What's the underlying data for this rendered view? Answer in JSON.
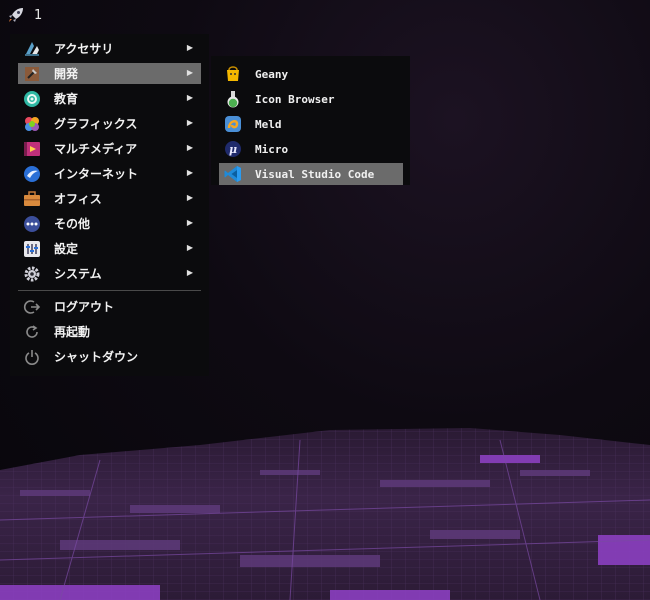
{
  "topbar": {
    "workspace": "1"
  },
  "main_menu": {
    "items": [
      {
        "label": "アクセサリ",
        "icon": "accessories-icon"
      },
      {
        "label": "開発",
        "icon": "development-icon"
      },
      {
        "label": "教育",
        "icon": "education-icon"
      },
      {
        "label": "グラフィックス",
        "icon": "graphics-icon"
      },
      {
        "label": "マルチメディア",
        "icon": "multimedia-icon"
      },
      {
        "label": "インターネット",
        "icon": "internet-icon"
      },
      {
        "label": "オフィス",
        "icon": "office-icon"
      },
      {
        "label": "その他",
        "icon": "other-icon"
      },
      {
        "label": "設定",
        "icon": "settings-icon"
      },
      {
        "label": "システム",
        "icon": "system-icon"
      }
    ],
    "session": [
      {
        "label": "ログアウト",
        "icon": "logout-icon"
      },
      {
        "label": "再起動",
        "icon": "reboot-icon"
      },
      {
        "label": "シャットダウン",
        "icon": "shutdown-icon"
      }
    ],
    "selected": "開発",
    "arrow": "▶"
  },
  "sub_menu": {
    "items": [
      {
        "label": "Geany",
        "icon": "geany-icon"
      },
      {
        "label": "Icon Browser",
        "icon": "icon-browser-icon"
      },
      {
        "label": "Meld",
        "icon": "meld-icon"
      },
      {
        "label": "Micro",
        "icon": "micro-icon"
      },
      {
        "label": "Visual Studio Code",
        "icon": "vscode-icon"
      }
    ],
    "selected": "Visual Studio Code"
  },
  "colors": {
    "menu_bg": "#0b0b0d",
    "highlight": "#6b6b6b",
    "text": "#f2f2f2"
  }
}
